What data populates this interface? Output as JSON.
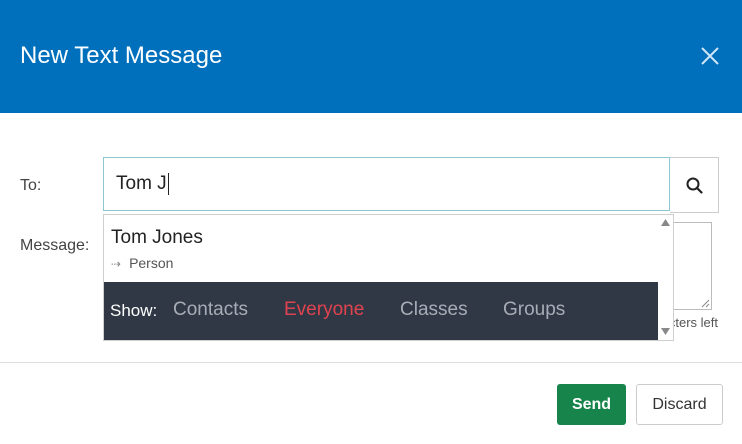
{
  "header": {
    "title": "New Text Message",
    "close_icon": "close-icon",
    "background_color": "#0070bd"
  },
  "form": {
    "to_label": "To:",
    "to_value": "Tom J",
    "message_label": "Message:",
    "search_icon": "search-icon",
    "chars_left_text": "characters left"
  },
  "autocomplete": {
    "results": [
      {
        "name": "Tom Jones",
        "type": "Person",
        "type_icon": "arrow-right-icon"
      }
    ],
    "show_label": "Show:",
    "filters": [
      {
        "label": "Contacts",
        "active": false
      },
      {
        "label": "Everyone",
        "active": true
      },
      {
        "label": "Classes",
        "active": false
      },
      {
        "label": "Groups",
        "active": false
      }
    ],
    "active_color": "#e0434f",
    "bar_color": "#313845"
  },
  "footer": {
    "send_label": "Send",
    "discard_label": "Discard",
    "send_color": "#16844b"
  }
}
